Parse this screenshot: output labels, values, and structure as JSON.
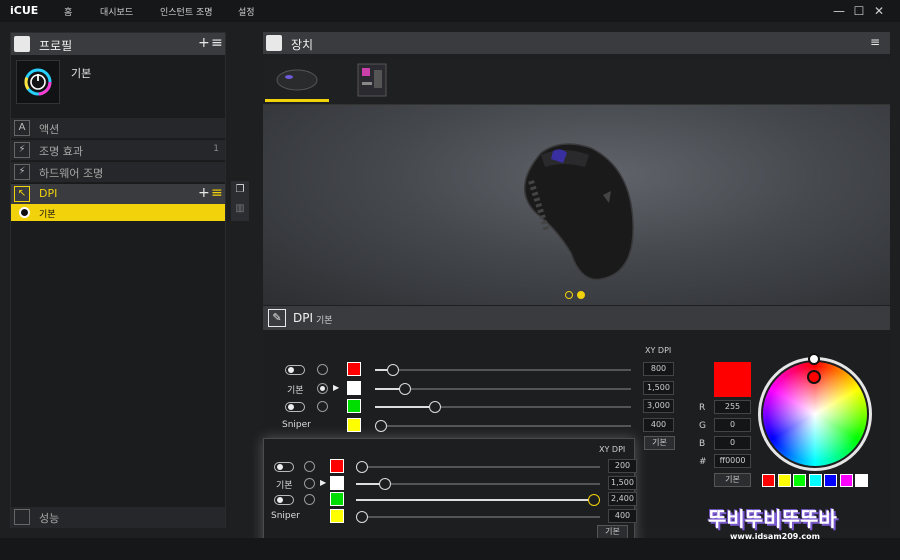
{
  "app": {
    "title": "iCUE"
  },
  "nav": {
    "items": [
      "홈",
      "대시보드",
      "인스턴트 조명",
      "설정"
    ]
  },
  "window_controls": {
    "minimize": "—",
    "maximize": "☐",
    "close": "✕"
  },
  "profile_panel": {
    "title": "프로필",
    "add": "+",
    "menu": "≡",
    "profile_name": "기본"
  },
  "menu": {
    "items": [
      {
        "icon_text": "A",
        "label": "액션",
        "count": ""
      },
      {
        "icon_text": "⚡",
        "label": "조명 효과",
        "count": "1"
      },
      {
        "icon_text": "⚡",
        "label": "하드웨어 조명",
        "count": ""
      }
    ],
    "dpi": {
      "label": "DPI",
      "add": "+",
      "menu": "≡"
    },
    "dpi_preset": "기본",
    "performance": "성능"
  },
  "device_panel": {
    "title": "장치",
    "menu": "≡"
  },
  "dpi_panel": {
    "title": "DPI",
    "subtitle": "기본",
    "xy_label": "XY DPI",
    "default_button": "기본",
    "stages": [
      {
        "name": "",
        "color": "#ff0000",
        "value": "800",
        "fraction": 0.05,
        "enabled": true,
        "active": false
      },
      {
        "name": "기본",
        "color": "#ffffff",
        "value": "1,500",
        "fraction": 0.1,
        "enabled": true,
        "active": true
      },
      {
        "name": "",
        "color": "#00dd00",
        "value": "3,000",
        "fraction": 0.22,
        "enabled": true,
        "active": false
      },
      {
        "name": "Sniper",
        "color": "#ffff00",
        "value": "400",
        "fraction": 0.0,
        "enabled": true,
        "active": false
      }
    ],
    "zoom_stages": [
      {
        "name": "",
        "color": "#ff0000",
        "value": "200",
        "fraction": 0.0
      },
      {
        "name": "기본",
        "color": "#ffffff",
        "value": "1,500",
        "fraction": 0.1
      },
      {
        "name": "",
        "color": "#00dd00",
        "value": "2,400",
        "fraction": 1.0
      },
      {
        "name": "Sniper",
        "color": "#ffff00",
        "value": "400",
        "fraction": 0.0
      }
    ]
  },
  "color_picker": {
    "preview": "#ff0000",
    "r_label": "R",
    "r": "255",
    "g_label": "G",
    "g": "0",
    "b_label": "B",
    "b": "0",
    "hex_label": "#",
    "hex": "ff0000",
    "default_button": "기본",
    "presets": [
      "#ff0000",
      "#ffff00",
      "#00ff00",
      "#00ffff",
      "#0000ff",
      "#ff00ff",
      "#ffffff"
    ]
  },
  "watermark": {
    "text": "뚜비뚜비뚜뚜바",
    "url": "www.idsam209.com"
  },
  "colors": {
    "accent": "#f2d20b"
  }
}
